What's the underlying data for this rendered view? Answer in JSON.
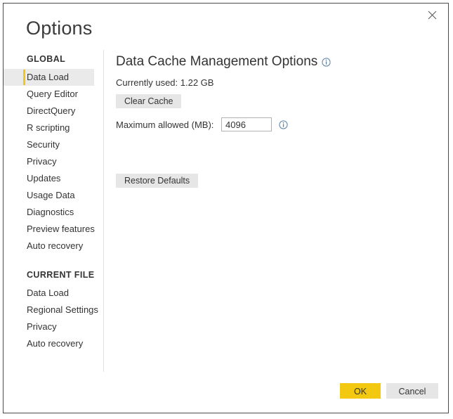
{
  "dialog": {
    "title": "Options",
    "close_icon": "close-icon"
  },
  "sidebar": {
    "groups": [
      {
        "title": "GLOBAL",
        "items": [
          {
            "label": "Data Load",
            "selected": true
          },
          {
            "label": "Query Editor",
            "selected": false
          },
          {
            "label": "DirectQuery",
            "selected": false
          },
          {
            "label": "R scripting",
            "selected": false
          },
          {
            "label": "Security",
            "selected": false
          },
          {
            "label": "Privacy",
            "selected": false
          },
          {
            "label": "Updates",
            "selected": false
          },
          {
            "label": "Usage Data",
            "selected": false
          },
          {
            "label": "Diagnostics",
            "selected": false
          },
          {
            "label": "Preview features",
            "selected": false
          },
          {
            "label": "Auto recovery",
            "selected": false
          }
        ]
      },
      {
        "title": "CURRENT FILE",
        "items": [
          {
            "label": "Data Load",
            "selected": false
          },
          {
            "label": "Regional Settings",
            "selected": false
          },
          {
            "label": "Privacy",
            "selected": false
          },
          {
            "label": "Auto recovery",
            "selected": false
          }
        ]
      }
    ]
  },
  "content": {
    "heading": "Data Cache Management Options",
    "heading_info_icon": "info-icon",
    "currently_used": "Currently used: 1.22 GB",
    "clear_cache_label": "Clear Cache",
    "max_allowed_label": "Maximum allowed (MB):",
    "max_allowed_value": "4096",
    "max_allowed_placeholder": "4096",
    "max_allowed_info_icon": "info-icon",
    "restore_defaults_label": "Restore Defaults"
  },
  "footer": {
    "ok_label": "OK",
    "cancel_label": "Cancel"
  },
  "colors": {
    "accent_yellow": "#f2c811",
    "button_gray": "#e6e6e6",
    "selected_row": "#eaeaea",
    "text": "#333333",
    "border": "#4c4c4c",
    "info_blue": "#4a6f9c"
  }
}
